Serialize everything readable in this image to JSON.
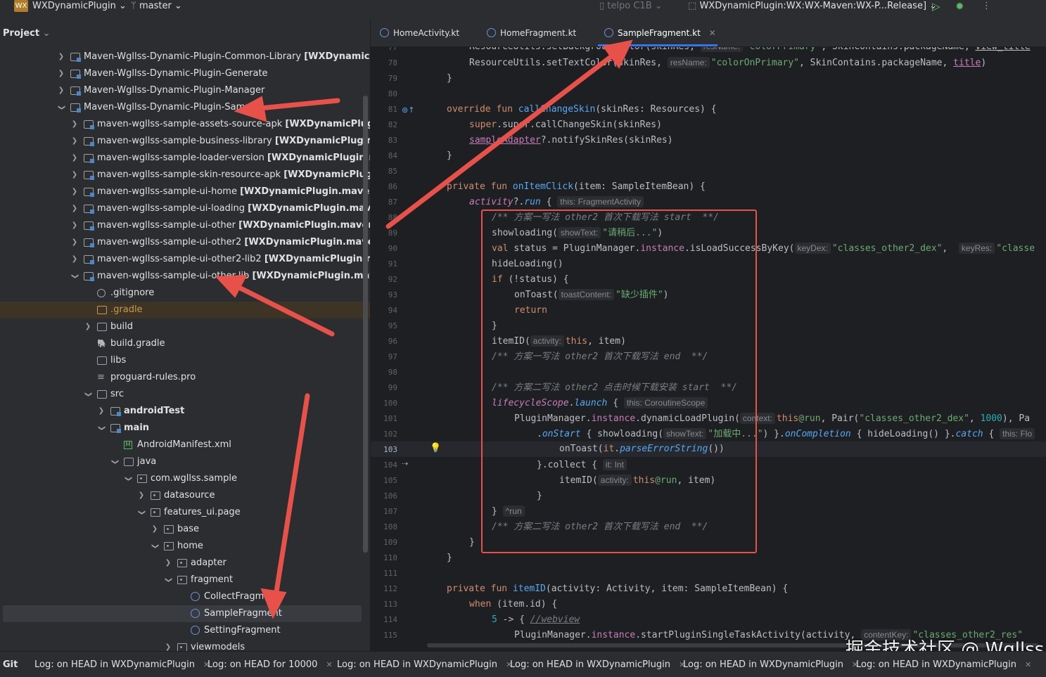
{
  "topbar": {
    "logo_text": "WX",
    "project_name": "WXDynamicPlugin",
    "branch": "master",
    "device": "telpo C1B",
    "run_config": "WXDynamicPlugin:WX:WX-Maven:WX-P...Release]"
  },
  "project_panel": {
    "title": "Project",
    "items": [
      {
        "label": "Maven-Wgllss-Dynamic-Plugin-Common-Library",
        "suffix": "[WXDynamicPlugin."
      },
      {
        "label": "Maven-Wgllss-Dynamic-Plugin-Generate",
        "suffix": ""
      },
      {
        "label": "Maven-Wgllss-Dynamic-Plugin-Manager",
        "suffix": ""
      },
      {
        "label": "Maven-Wgllss-Dynamic-Plugin-Sample",
        "suffix": ""
      },
      {
        "label": "maven-wgllss-sample-assets-source-apk",
        "suffix": "[WXDynamicPlugin.mav"
      },
      {
        "label": "maven-wgllss-sample-business-library",
        "suffix": "[WXDynamicPlugin.maven"
      },
      {
        "label": "maven-wgllss-sample-loader-version",
        "suffix": "[WXDynamicPlugin.maven-"
      },
      {
        "label": "maven-wgllss-sample-skin-resource-apk",
        "suffix": "[WXDynamicPlugin.mav"
      },
      {
        "label": "maven-wgllss-sample-ui-home",
        "suffix": "[WXDynamicPlugin.maven-wgllss"
      },
      {
        "label": "maven-wgllss-sample-ui-loading",
        "suffix": "[WXDynamicPlugin.maven-wgll"
      },
      {
        "label": "maven-wgllss-sample-ui-other",
        "suffix": "[WXDynamicPlugin.maven-wgllss"
      },
      {
        "label": "maven-wgllss-sample-ui-other2",
        "suffix": "[WXDynamicPlugin.maven-wglls"
      },
      {
        "label": "maven-wgllss-sample-ui-other2-lib2",
        "suffix": "[WXDynamicPlugin.maven-v"
      },
      {
        "label": "maven-wgllss-sample-ui-other-lib",
        "suffix": "[WXDynamicPlugin.maven-wgl"
      },
      {
        "label": ".gitignore",
        "suffix": ""
      },
      {
        "label": ".gradle",
        "suffix": ""
      },
      {
        "label": "build",
        "suffix": ""
      },
      {
        "label": "build.gradle",
        "suffix": ""
      },
      {
        "label": "libs",
        "suffix": ""
      },
      {
        "label": "proguard-rules.pro",
        "suffix": ""
      },
      {
        "label": "src",
        "suffix": ""
      },
      {
        "label": "androidTest",
        "suffix": ""
      },
      {
        "label": "main",
        "suffix": ""
      },
      {
        "label": "AndroidManifest.xml",
        "suffix": ""
      },
      {
        "label": "java",
        "suffix": ""
      },
      {
        "label": "com.wgllss.sample",
        "suffix": ""
      },
      {
        "label": "datasource",
        "suffix": ""
      },
      {
        "label": "features_ui.page",
        "suffix": ""
      },
      {
        "label": "base",
        "suffix": ""
      },
      {
        "label": "home",
        "suffix": ""
      },
      {
        "label": "adapter",
        "suffix": ""
      },
      {
        "label": "fragment",
        "suffix": ""
      },
      {
        "label": "CollectFragment",
        "suffix": ""
      },
      {
        "label": "SampleFragment",
        "suffix": ""
      },
      {
        "label": "SettingFragment",
        "suffix": ""
      },
      {
        "label": "viewmodels",
        "suffix": ""
      }
    ]
  },
  "tabs": [
    {
      "label": "HomeActivity.kt"
    },
    {
      "label": "HomeFragment.kt"
    },
    {
      "label": "SampleFragment.kt"
    }
  ],
  "line_numbers": [
    "77",
    "78",
    "79",
    "80",
    "81",
    "82",
    "83",
    "84",
    "85",
    "86",
    "87",
    "88",
    "89",
    "90",
    "91",
    "92",
    "93",
    "94",
    "95",
    "96",
    "97",
    "98",
    "99",
    "100",
    "101",
    "102",
    "103",
    "104",
    "105",
    "106",
    "107",
    "108",
    "109",
    "110",
    "111",
    "112",
    "113",
    "114",
    "115"
  ],
  "code": {
    "l78_a": "ResourceUtils.setTextColor(skinRes, ",
    "l78_hint": "resName:",
    "l78_str": "\"colorOnPrimary\"",
    "l78_b": ", SkinContains.packageName, ",
    "l78_c": "title",
    "l78_d": ")",
    "l81_kw": "override fun ",
    "l81_fn": "callChangeSkin",
    "l81_rest": "(skinRes: Resources) {",
    "l82": "super.callChangeSkin(skinRes)",
    "l83_a": "sampleAdapter",
    "l83_b": "?.notifySkinRes(skinRes)",
    "l86_kw": "private fun ",
    "l86_fn": "onItemClick",
    "l86_rest": "(item: SampleItemBean) {",
    "l87_a": "activity",
    "l87_b": "?.",
    "l87_c": "run",
    "l87_d": " { ",
    "l87_hint": "this: FragmentActivity",
    "l88": "/** 方案一写法 other2 首次下载写法 start  **/",
    "l89_a": "showloading(",
    "l89_hint": "showText:",
    "l89_str": "\"请稍后...\"",
    "l89_b": ")",
    "l90_kw": "val ",
    "l90_a": "status = PluginManager.",
    "l90_prop": "instance",
    "l90_b": ".isLoadSuccessByKey(",
    "l90_hint1": "keyDex:",
    "l90_str1": "\"classes_other2_dex\"",
    "l90_c": ",  ",
    "l90_hint2": "keyRes:",
    "l90_str2": "\"classe",
    "l91": "hideLoading()",
    "l92_kw": "if ",
    "l92_rest": "(!status) {",
    "l93_a": "onToast(",
    "l93_hint": "toastContent:",
    "l93_str": "\"缺少插件\"",
    "l93_b": ")",
    "l94": "return",
    "l95": "}",
    "l96_a": "itemID(",
    "l96_hint": "activity:",
    "l96_kw": "this",
    "l96_b": ", item)",
    "l97": "/** 方案一写法 other2 首次下载写法 end  **/",
    "l99": "/** 方案二写法 other2 点击时候下载安装 start  **/",
    "l100_a": "lifecycleScope",
    "l100_b": ".",
    "l100_c": "launch",
    "l100_d": " { ",
    "l100_hint": "this: CoroutineScope",
    "l101_a": "PluginManager.",
    "l101_prop": "instance",
    "l101_b": ".dynamicLoadPlugin(",
    "l101_hint": "context:",
    "l101_kw": "this",
    "l101_at": "@run",
    "l101_c": ", Pair(",
    "l101_str": "\"classes_other2_dex\"",
    "l101_d": ", ",
    "l101_num": "1000",
    "l101_e": "), Pa",
    "l102_a": ".",
    "l102_b": "onStart",
    "l102_c": " { showloading(",
    "l102_hint": "showText:",
    "l102_str": "\"加载中...\"",
    "l102_d": ") }.",
    "l102_e": "onCompletion",
    "l102_f": " { hideLoading() }.",
    "l102_g": "catch",
    "l102_h": " { ",
    "l102_hint2": "this: Flo",
    "l103_a": "onToast(",
    "l103_b": "it",
    "l103_c": ".",
    "l103_d": "parseErrorString",
    "l103_e": "())",
    "l104_a": "}.collect { ",
    "l104_hint": "it: Int",
    "l105_a": "itemID(",
    "l105_hint": "activity:",
    "l105_kw": "this",
    "l105_at": "@run",
    "l105_b": ", item)",
    "l106": "}",
    "l107_a": "} ",
    "l107_hint": "^run",
    "l108": "/** 方案二写法 other2 首次下载写法 end  **/",
    "l109": "}",
    "l110": "}",
    "l112_kw": "private fun ",
    "l112_fn": "itemID",
    "l112_rest": "(activity: Activity, item: SampleItemBean) {",
    "l113_kw": "when ",
    "l113_rest": "(item.id) {",
    "l114_num": "5",
    "l114_a": " -> { ",
    "l114_cmt": "//webview",
    "l115_a": "PluginManager.",
    "l115_prop": "instance",
    "l115_b": ".startPluginSingleTaskActivity(activity, ",
    "l115_hint": "contentKey:",
    "l115_str": "\"classes_other2_res\""
  },
  "bottombar": {
    "git_label": "Git",
    "tabs": [
      "Log: on HEAD in WXDynamicPlugin",
      "Log: on HEAD for 10000",
      "Log: on HEAD in WXDynamicPlugin",
      "Log: on HEAD in WXDynamicPlugin",
      "Log: on HEAD in WXDynamicPlugin",
      "Log: on HEAD in WXDynamicPlugin"
    ]
  },
  "watermark": "掘金技术社区 @ Wgllss",
  "colors": {
    "annotation_red": "#e8514a",
    "accent": "#3574f0"
  }
}
